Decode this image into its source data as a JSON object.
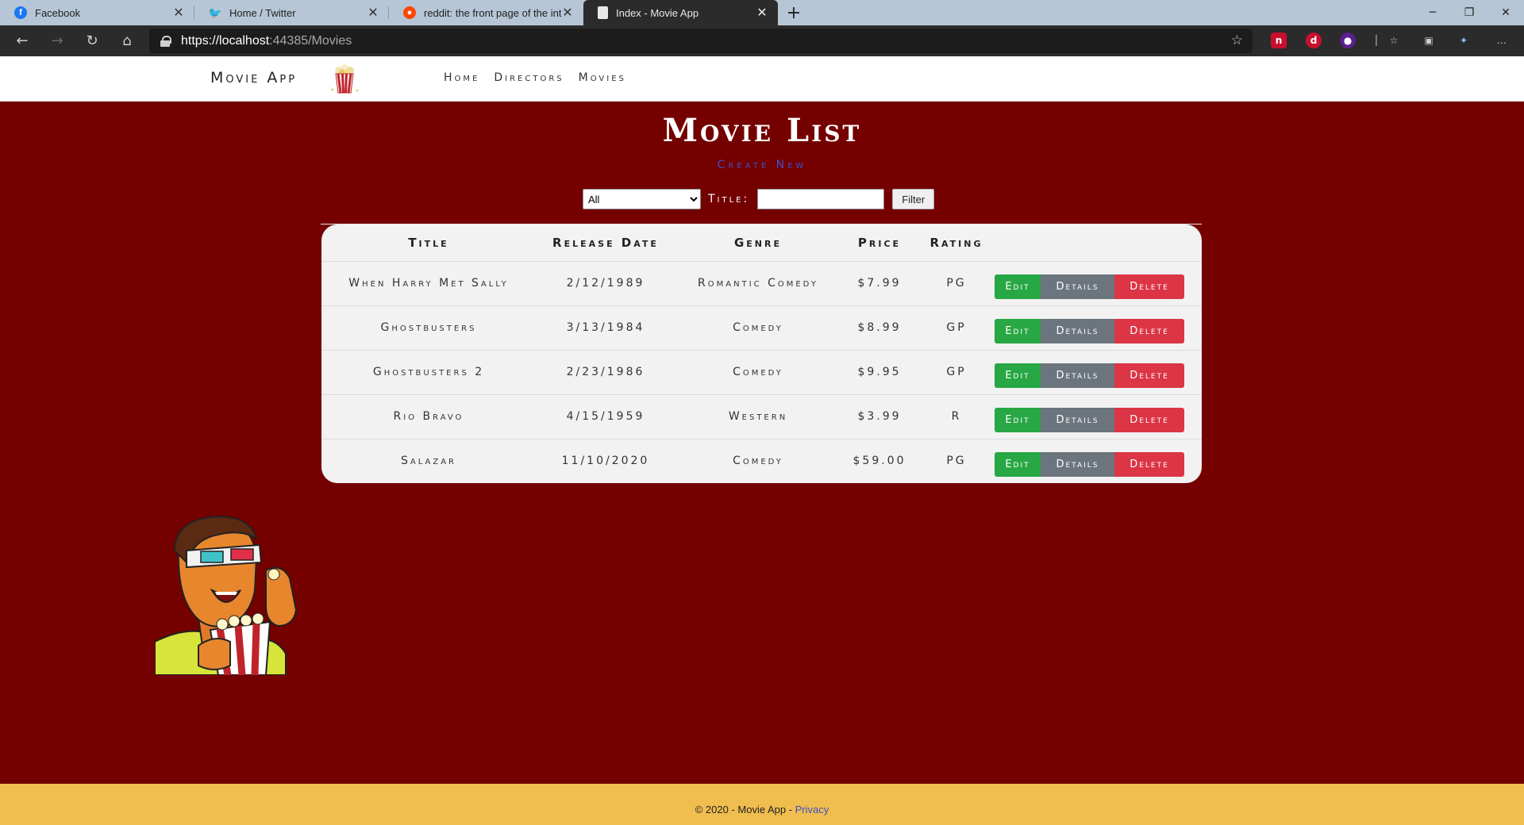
{
  "browser": {
    "tabs": [
      {
        "title": "Facebook",
        "icon": "facebook-icon",
        "color": "#1877f2"
      },
      {
        "title": "Home / Twitter",
        "icon": "twitter-icon",
        "color": "#1da1f2"
      },
      {
        "title": "reddit: the front page of the internet",
        "icon": "reddit-icon",
        "color": "#ff4500"
      },
      {
        "title": "Index - Movie App",
        "icon": "page-icon",
        "color": "#e8e8e8"
      }
    ],
    "url_host": "https://localhost",
    "url_rest": ":44385/Movies"
  },
  "header": {
    "brand": "Movie App",
    "nav": [
      "Home",
      "Directors",
      "Movies"
    ]
  },
  "main": {
    "title": "Movie List",
    "create_new": "Create New",
    "genre_selected": "All",
    "title_label": "Title:",
    "filter_button": "Filter",
    "columns": [
      "Title",
      "Release Date",
      "Genre",
      "Price",
      "Rating"
    ],
    "movies": [
      {
        "title": "When Harry Met Sally",
        "release": "2/12/1989",
        "genre": "Romantic Comedy",
        "price": "$7.99",
        "rating": "PG"
      },
      {
        "title": "Ghostbusters",
        "release": "3/13/1984",
        "genre": "Comedy",
        "price": "$8.99",
        "rating": "GP"
      },
      {
        "title": "Ghostbusters 2",
        "release": "2/23/1986",
        "genre": "Comedy",
        "price": "$9.95",
        "rating": "GP"
      },
      {
        "title": "Rio Bravo",
        "release": "4/15/1959",
        "genre": "Western",
        "price": "$3.99",
        "rating": "R"
      },
      {
        "title": "Salazar",
        "release": "11/10/2020",
        "genre": "Comedy",
        "price": "$59.00",
        "rating": "PG"
      }
    ],
    "actions": {
      "edit": "Edit",
      "details": "Details",
      "delete": "Delete"
    }
  },
  "footer": {
    "text": "© 2020 - Movie App - ",
    "privacy": "Privacy"
  },
  "colors": {
    "page_bg": "#740000",
    "footer_bg": "#f0bd4f",
    "edit": "#28a745",
    "details": "#6c757d",
    "delete": "#dc3545",
    "link": "#3f51c5"
  }
}
